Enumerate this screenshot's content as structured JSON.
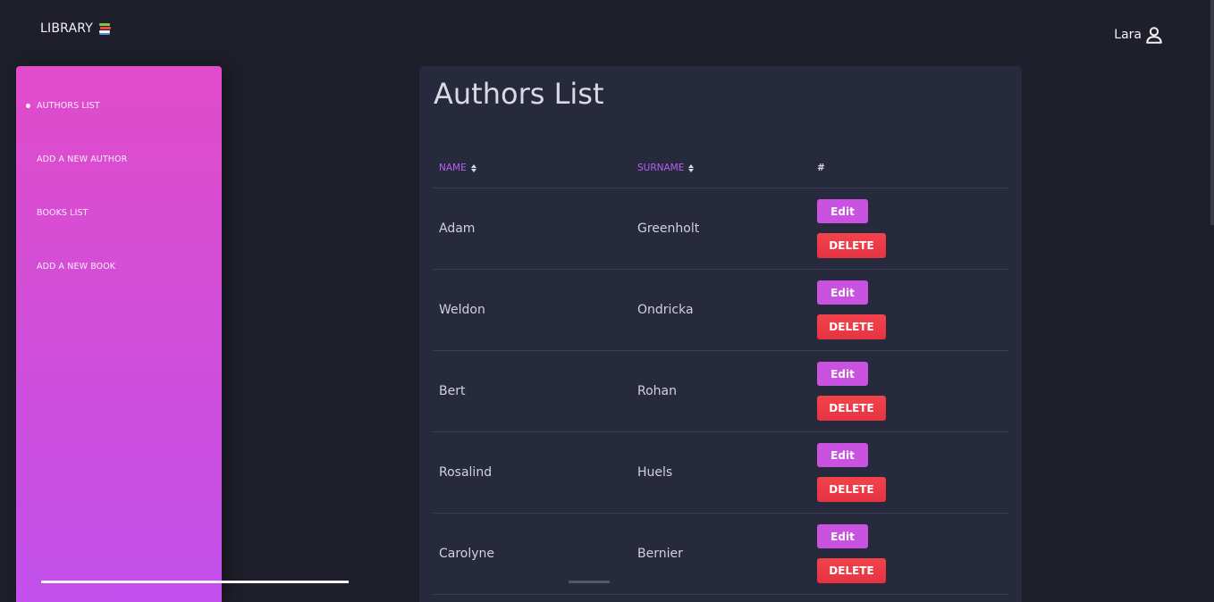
{
  "header": {
    "brand": "LIBRARY",
    "brand_icon": "books-icon",
    "user_name": "Lara",
    "user_icon": "user-icon"
  },
  "sidebar": {
    "items": [
      {
        "label": "AUTHORS LIST",
        "active": true
      },
      {
        "label": "ADD A NEW AUTHOR",
        "active": false
      },
      {
        "label": "BOOKS LIST",
        "active": false
      },
      {
        "label": "ADD A NEW BOOK",
        "active": false
      }
    ]
  },
  "main": {
    "title": "Authors List",
    "columns": [
      "NAME",
      "SURNAME",
      "#"
    ],
    "edit_label": "Edit",
    "delete_label": "DELETE",
    "rows": [
      {
        "name": "Adam",
        "surname": "Greenholt"
      },
      {
        "name": "Weldon",
        "surname": "Ondricka"
      },
      {
        "name": "Bert",
        "surname": "Rohan"
      },
      {
        "name": "Rosalind",
        "surname": "Huels"
      },
      {
        "name": "Carolyne",
        "surname": "Bernier"
      }
    ]
  },
  "colors": {
    "background": "#1f1f2b",
    "card": "#272a3d",
    "accent": "#b760f2",
    "edit": "#c953e0",
    "delete": "#e63342",
    "sidebar_top": "#e14ccb",
    "sidebar_bottom": "#c350ee"
  }
}
